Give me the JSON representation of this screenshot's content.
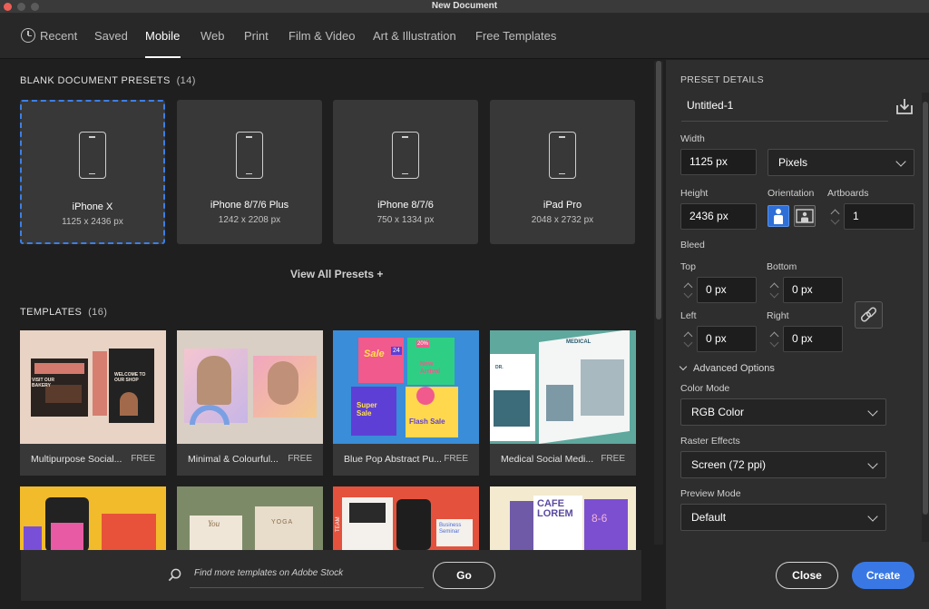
{
  "window": {
    "title": "New Document"
  },
  "colors": {
    "accent": "#3978e4",
    "selection": "#3d7fe6",
    "traffic_close": "#ec5f57",
    "traffic_min": "#5b5b5b",
    "traffic_max": "#5b5b5b"
  },
  "tabs": [
    {
      "label": "Recent",
      "icon": "clock-icon"
    },
    {
      "label": "Saved"
    },
    {
      "label": "Mobile",
      "active": true
    },
    {
      "label": "Web"
    },
    {
      "label": "Print"
    },
    {
      "label": "Film & Video"
    },
    {
      "label": "Art & Illustration"
    },
    {
      "label": "Free Templates"
    }
  ],
  "presets": {
    "title": "BLANK DOCUMENT PRESETS",
    "count": "(14)",
    "items": [
      {
        "name": "iPhone X",
        "size": "1125 x 2436 px",
        "selected": true
      },
      {
        "name": "iPhone 8/7/6 Plus",
        "size": "1242 x 2208 px"
      },
      {
        "name": "iPhone 8/7/6",
        "size": "750 x 1334 px"
      },
      {
        "name": "iPad Pro",
        "size": "2048 x 2732 px"
      }
    ],
    "view_all": "View All Presets +"
  },
  "templates": {
    "title": "TEMPLATES",
    "count": "(16)",
    "items": [
      {
        "name": "Multipurpose Social...",
        "badge": "FREE",
        "thumb_text": [
          "VISIT OUR BAKERY",
          "WELCOME TO OUR SHOP"
        ]
      },
      {
        "name": "Minimal & Colourful...",
        "badge": "FREE"
      },
      {
        "name": "Blue Pop Abstract Pu...",
        "badge": "FREE",
        "thumb_text": [
          "Sale",
          "New Arrival",
          "Super Sale",
          "Flash Sale",
          "24",
          "20%"
        ]
      },
      {
        "name": "Medical Social Medi...",
        "badge": "FREE",
        "thumb_text": [
          "MEDICAL",
          "DR."
        ]
      }
    ],
    "row2": [
      {
        "thumb_text": []
      },
      {
        "thumb_text": [
          "You",
          "YOGA"
        ]
      },
      {
        "thumb_text": [
          "TEAM",
          "Business Seminar"
        ]
      },
      {
        "thumb_text": [
          "CAFE LOREM",
          "8-6"
        ]
      }
    ]
  },
  "stock": {
    "placeholder": "Find more templates on Adobe Stock",
    "go_label": "Go"
  },
  "details": {
    "header": "PRESET DETAILS",
    "doc_name": "Untitled-1",
    "width_label": "Width",
    "width_value": "1125 px",
    "unit": "Pixels",
    "height_label": "Height",
    "height_value": "2436 px",
    "orientation_label": "Orientation",
    "artboards_label": "Artboards",
    "artboards_value": "1",
    "bleed_label": "Bleed",
    "top_label": "Top",
    "top_value": "0 px",
    "bottom_label": "Bottom",
    "bottom_value": "0 px",
    "left_label": "Left",
    "left_value": "0 px",
    "right_label": "Right",
    "right_value": "0 px",
    "advanced_label": "Advanced Options",
    "color_mode_label": "Color Mode",
    "color_mode_value": "RGB Color",
    "raster_label": "Raster Effects",
    "raster_value": "Screen (72 ppi)",
    "preview_label": "Preview Mode",
    "preview_value": "Default"
  },
  "actions": {
    "close_label": "Close",
    "create_label": "Create"
  }
}
